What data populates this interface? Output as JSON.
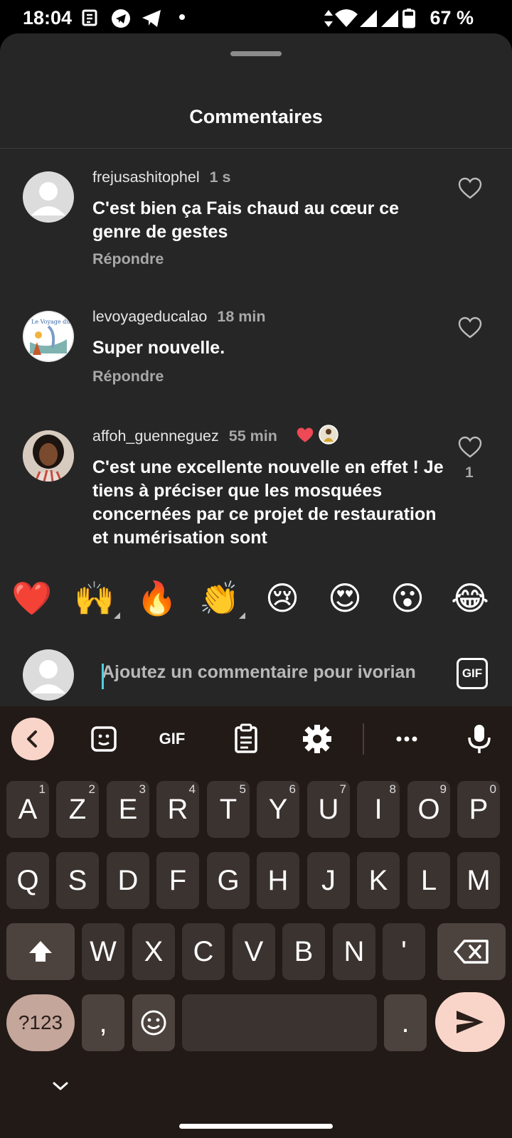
{
  "status_bar": {
    "time": "18:04",
    "battery": "67 %"
  },
  "sheet": {
    "title": "Commentaires"
  },
  "comments": [
    {
      "username": "frejusashitophel",
      "time": "1 s",
      "text": "C'est bien ça Fais chaud au cœur ce genre de gestes",
      "reply": "Répondre",
      "likes": ""
    },
    {
      "username": "levoyageducalao",
      "time": "18 min",
      "text": "Super nouvelle.",
      "reply": "Répondre",
      "likes": ""
    },
    {
      "username": "affoh_guenneguez",
      "time": "55 min",
      "text": "C'est une excellente nouvelle en effet ! Je tiens à préciser que les mosquées concernées par ce projet de restauration et numérisation sont",
      "reply": "",
      "likes": "1"
    }
  ],
  "reactions": [
    "❤️",
    "🙌",
    "🔥",
    "👏",
    "😢",
    "😍",
    "😮",
    "😂"
  ],
  "compose": {
    "placeholder": "Ajoutez un commentaire pour ivorian",
    "gif_label": "GIF"
  },
  "keyboard": {
    "toolbar": {
      "gif": "GIF"
    },
    "row1": [
      {
        "k": "A",
        "s": "1"
      },
      {
        "k": "Z",
        "s": "2"
      },
      {
        "k": "E",
        "s": "3"
      },
      {
        "k": "R",
        "s": "4"
      },
      {
        "k": "T",
        "s": "5"
      },
      {
        "k": "Y",
        "s": "6"
      },
      {
        "k": "U",
        "s": "7"
      },
      {
        "k": "I",
        "s": "8"
      },
      {
        "k": "O",
        "s": "9"
      },
      {
        "k": "P",
        "s": "0"
      }
    ],
    "row2": [
      "Q",
      "S",
      "D",
      "F",
      "G",
      "H",
      "J",
      "K",
      "L",
      "M"
    ],
    "row3": [
      "W",
      "X",
      "C",
      "V",
      "B",
      "N",
      "'"
    ],
    "symbols": "?123",
    "comma": ",",
    "period": "."
  },
  "colors": {
    "sheet_bg": "#262626",
    "keyboard_bg": "#221a17",
    "key_bg": "#3b3330",
    "accent": "#f9d5c9",
    "heart": "#ed4956"
  }
}
